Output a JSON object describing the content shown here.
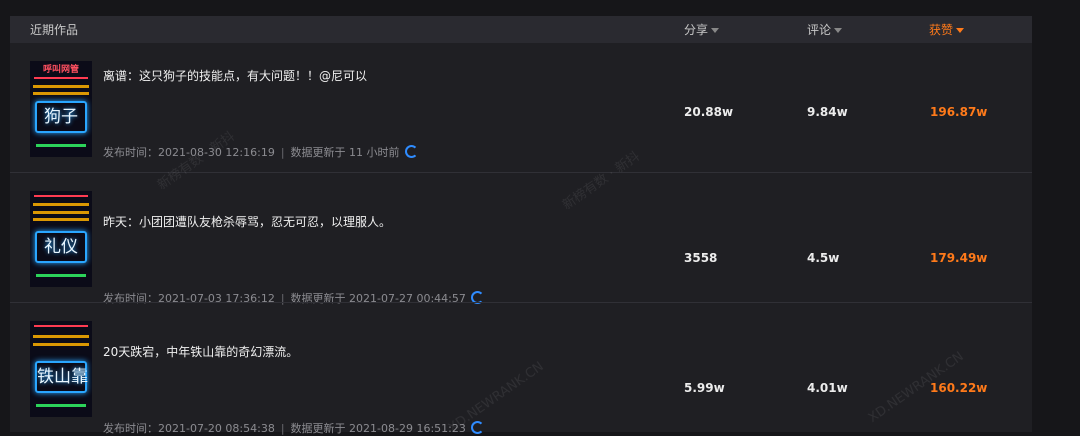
{
  "header": {
    "title": "近期作品",
    "col_share": "分享",
    "col_comment": "评论",
    "col_like": "获赞"
  },
  "colors": {
    "accent": "#ff7a1a",
    "refresh": "#2f8cff"
  },
  "rows": [
    {
      "thumb_top": "呼叫网管",
      "thumb_main": "狗子",
      "title": "离谱：这只狗子的技能点，有大问题！！@尼可以",
      "publish": "发布时间：2021-08-30 12:16:19",
      "updated": "数据更新于 11 小时前",
      "share": "20.88w",
      "comment": "9.84w",
      "like": "196.87w"
    },
    {
      "thumb_top": "",
      "thumb_main": "礼仪",
      "title": "昨天：小团团遭队友枪杀辱骂，忍无可忍，以理服人。",
      "publish": "发布时间：2021-07-03 17:36:12",
      "updated": "数据更新于 2021-07-27 00:44:57",
      "share": "3558",
      "comment": "4.5w",
      "like": "179.49w"
    },
    {
      "thumb_top": "",
      "thumb_main": "铁山靠",
      "title": "20天跌宕，中年铁山靠的奇幻漂流。",
      "publish": "发布时间：2021-07-20 08:54:38",
      "updated": "数据更新于 2021-08-29 16:51:23",
      "share": "5.99w",
      "comment": "4.01w",
      "like": "160.22w"
    }
  ],
  "watermarks": [
    "新榜有数 · 新抖",
    "新榜有数 · 新抖",
    "XD.NEWRANK.CN",
    "XD.NEWRANK.CN"
  ]
}
